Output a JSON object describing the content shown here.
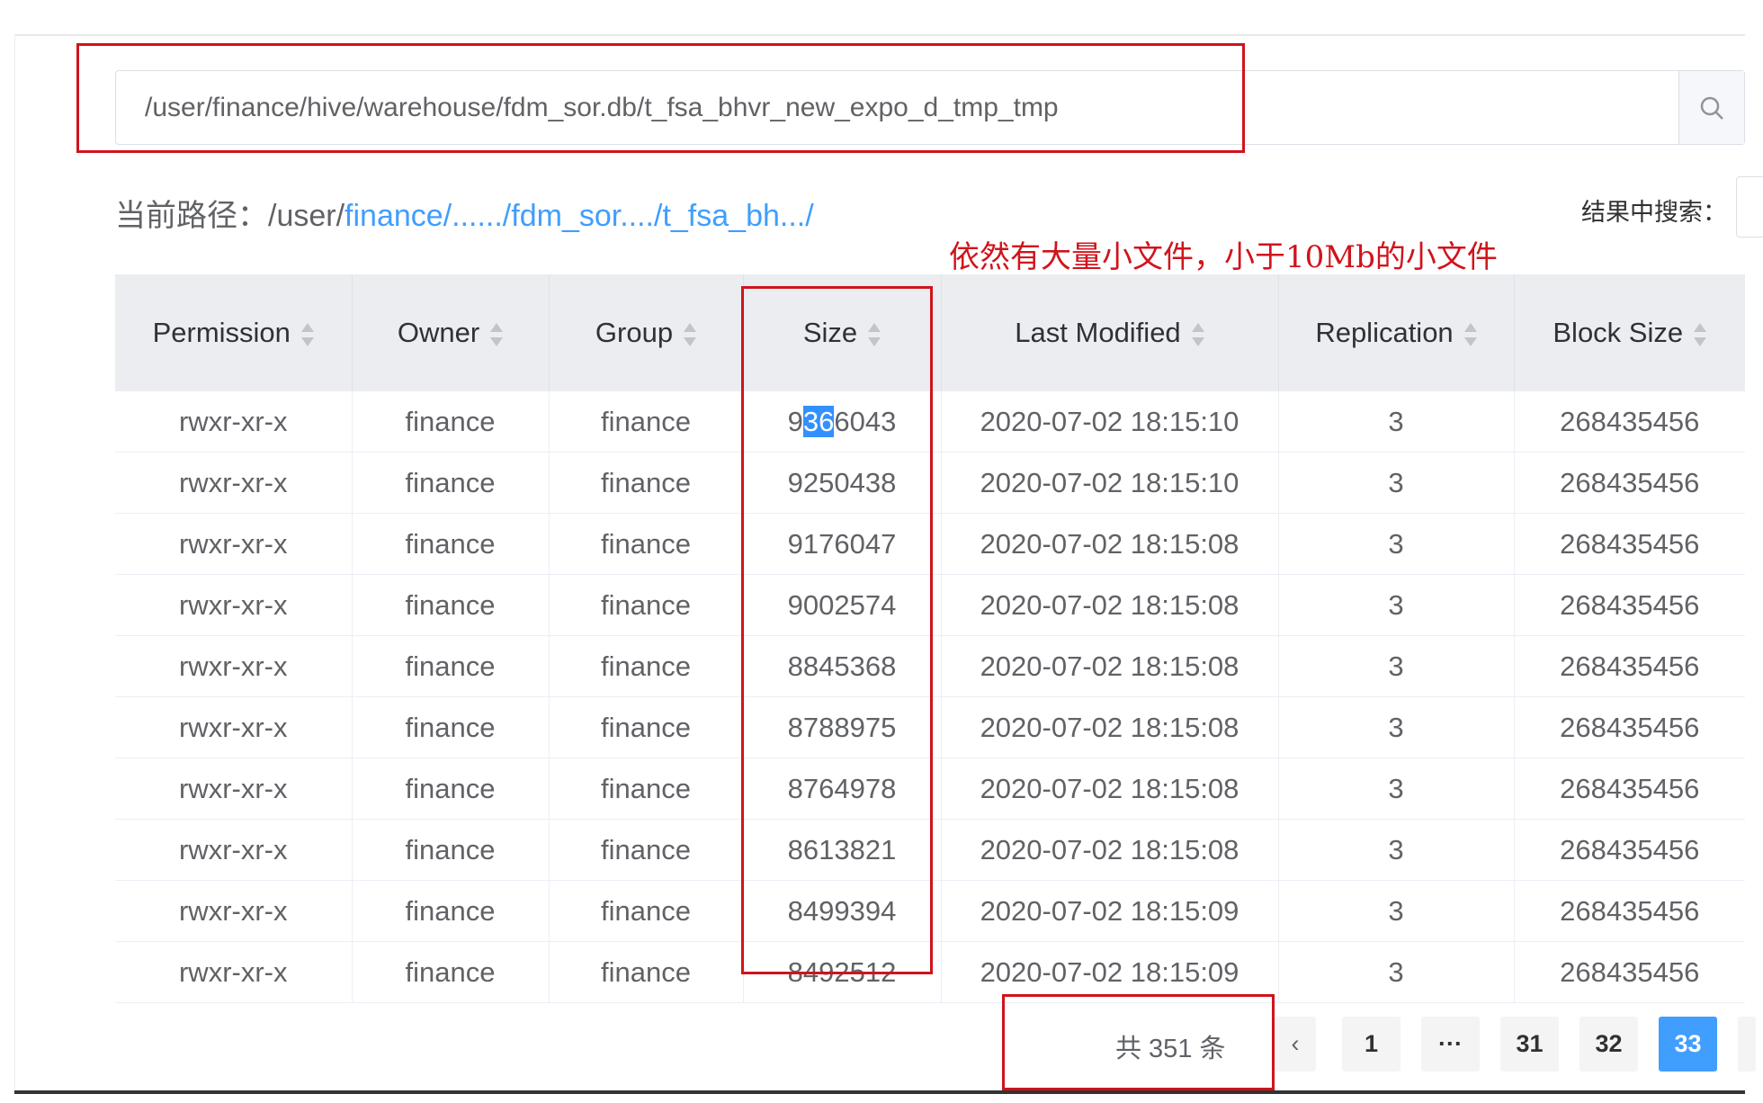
{
  "search": {
    "value": "/user/finance/hive/warehouse/fdm_sor.db/t_fsa_bhvr_new_expo_d_tmp_tmp",
    "button_icon": "search-icon"
  },
  "breadcrumb": {
    "label": "当前路径：",
    "root": "/user/",
    "parts": [
      "finance",
      "/....../",
      "fdm_sor..../",
      "t_fsa_bh.../"
    ]
  },
  "filter": {
    "label": "结果中搜索："
  },
  "annotation": "依然有大量小文件，小于10Mb的小文件",
  "table": {
    "columns": [
      "Permission",
      "Owner",
      "Group",
      "Size",
      "Last Modified",
      "Replication",
      "Block Size"
    ],
    "rows": [
      [
        "rwxr-xr-x",
        "finance",
        "finance",
        "9366043",
        "2020-07-02 18:15:10",
        "3",
        "268435456"
      ],
      [
        "rwxr-xr-x",
        "finance",
        "finance",
        "9250438",
        "2020-07-02 18:15:10",
        "3",
        "268435456"
      ],
      [
        "rwxr-xr-x",
        "finance",
        "finance",
        "9176047",
        "2020-07-02 18:15:08",
        "3",
        "268435456"
      ],
      [
        "rwxr-xr-x",
        "finance",
        "finance",
        "9002574",
        "2020-07-02 18:15:08",
        "3",
        "268435456"
      ],
      [
        "rwxr-xr-x",
        "finance",
        "finance",
        "8845368",
        "2020-07-02 18:15:08",
        "3",
        "268435456"
      ],
      [
        "rwxr-xr-x",
        "finance",
        "finance",
        "8788975",
        "2020-07-02 18:15:08",
        "3",
        "268435456"
      ],
      [
        "rwxr-xr-x",
        "finance",
        "finance",
        "8764978",
        "2020-07-02 18:15:08",
        "3",
        "268435456"
      ],
      [
        "rwxr-xr-x",
        "finance",
        "finance",
        "8613821",
        "2020-07-02 18:15:08",
        "3",
        "268435456"
      ],
      [
        "rwxr-xr-x",
        "finance",
        "finance",
        "8499394",
        "2020-07-02 18:15:09",
        "3",
        "268435456"
      ],
      [
        "rwxr-xr-x",
        "finance",
        "finance",
        "8492512",
        "2020-07-02 18:15:09",
        "3",
        "268435456"
      ]
    ]
  },
  "pagination": {
    "total": "共 351 条",
    "prev": "‹",
    "pages": [
      "1",
      "···",
      "31",
      "32",
      "33"
    ],
    "current": "33"
  },
  "colors": {
    "accent": "#409eff",
    "annotation_red": "#d0141c"
  }
}
